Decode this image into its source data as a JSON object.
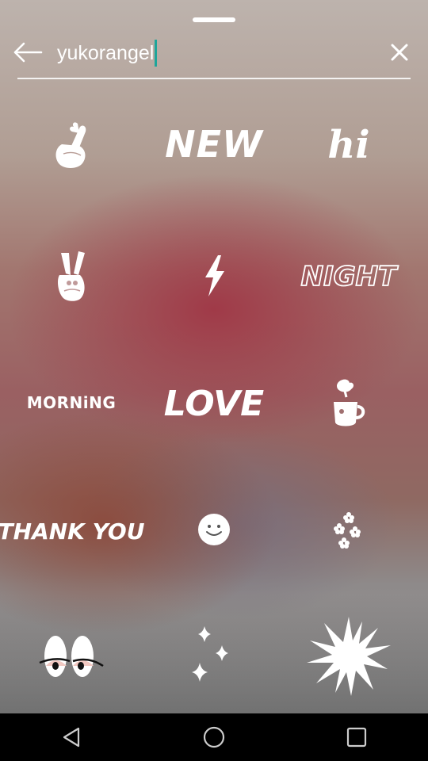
{
  "search": {
    "query": "yukorangel",
    "back_icon": "arrow-left-icon",
    "clear_icon": "close-icon"
  },
  "stickers": [
    {
      "name": "finger-heart",
      "icon": "finger-heart-hand-icon"
    },
    {
      "name": "new",
      "text": "NEW"
    },
    {
      "name": "hi",
      "text": "hi"
    },
    {
      "name": "peace-sign",
      "icon": "peace-sign-hand-icon"
    },
    {
      "name": "lightning",
      "icon": "lightning-bolt-icon"
    },
    {
      "name": "night",
      "text": "NIGHT"
    },
    {
      "name": "morning",
      "text": "MORNiNG"
    },
    {
      "name": "love",
      "text": "LOVE"
    },
    {
      "name": "coffee",
      "icon": "coffee-cup-icon"
    },
    {
      "name": "thank-you",
      "text": "THANK YOU"
    },
    {
      "name": "smiley",
      "icon": "smiley-face-icon"
    },
    {
      "name": "flowers",
      "icon": "small-flowers-icon"
    },
    {
      "name": "eyes",
      "icon": "eyes-icon"
    },
    {
      "name": "sparkles",
      "icon": "sparkles-icon"
    },
    {
      "name": "starburst",
      "icon": "starburst-icon"
    }
  ],
  "navbar": {
    "back_icon": "nav-back-triangle-icon",
    "home_icon": "nav-home-circle-icon",
    "recents_icon": "nav-recents-square-icon"
  },
  "colors": {
    "caret": "#1ea59a",
    "icon": "#ffffff",
    "navbar": "#000000"
  }
}
